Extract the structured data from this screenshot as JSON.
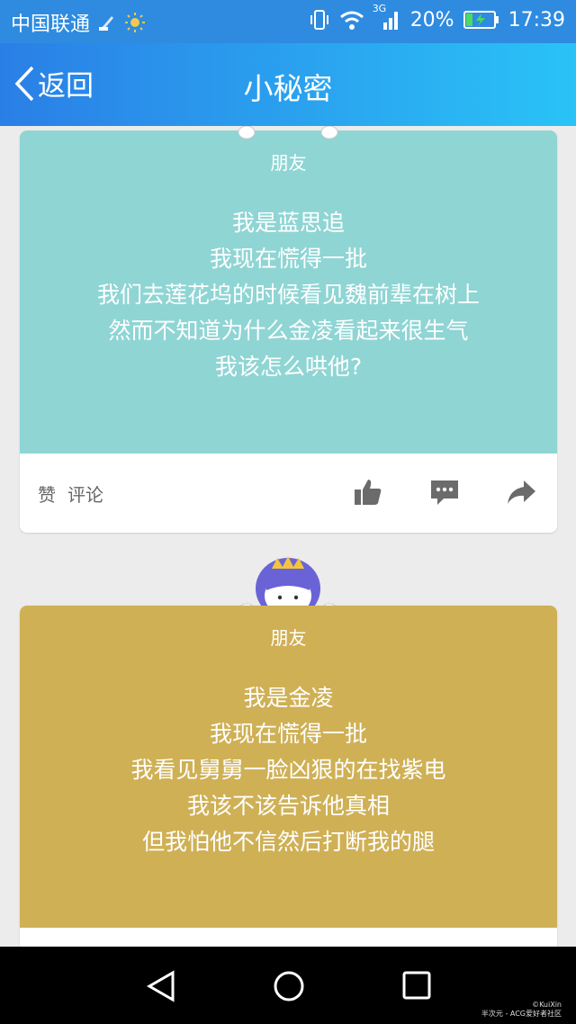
{
  "status_bar": {
    "carrier": "中国联通",
    "network": "3G",
    "battery": "20%",
    "time": "17:39",
    "icons": [
      "broom-icon",
      "sun-icon",
      "vibrate-icon",
      "wifi-icon",
      "signal-icon",
      "battery-charging-icon"
    ]
  },
  "header": {
    "back_label": "返回",
    "title": "小秘密"
  },
  "cards": [
    {
      "tag": "朋友",
      "bg": "#8fd5d4",
      "lines": [
        "我是蓝思追",
        "我现在慌得一批",
        "我们去莲花坞的时候看见魏前辈在树上",
        "然而不知道为什么金凌看起来很生气",
        "我该怎么哄他?"
      ],
      "like_label": "赞",
      "comment_label": "评论"
    },
    {
      "tag": "朋友",
      "bg": "#cfb055",
      "lines": [
        "我是金凌",
        "我现在慌得一批",
        "我看见舅舅一脸凶狠的在找紫电",
        "我该不该告诉他真相",
        "但我怕他不信然后打断我的腿"
      ]
    }
  ],
  "watermark": [
    "©KuiXin",
    "半次元 - ACG爱好者社区"
  ]
}
